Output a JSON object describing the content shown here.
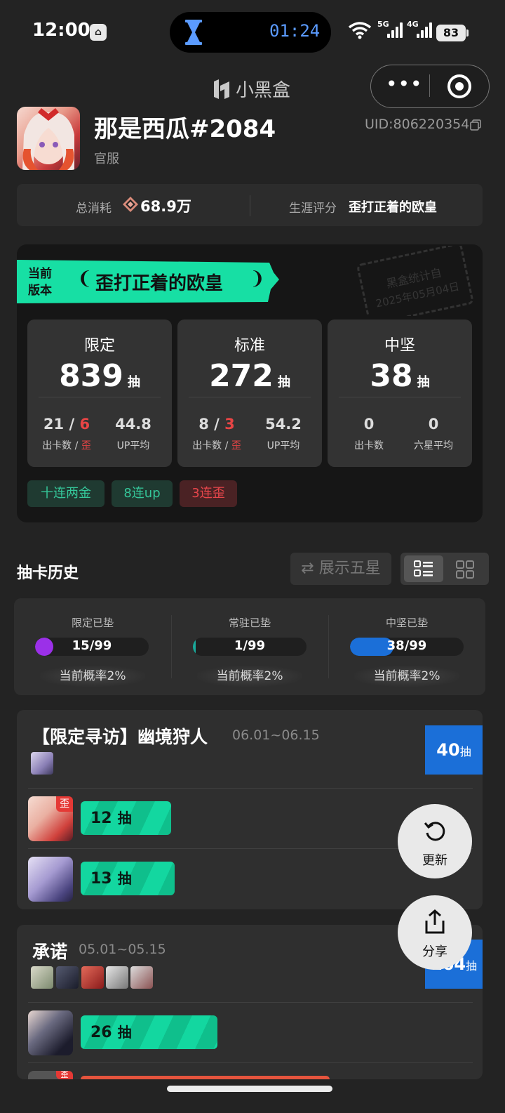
{
  "status_bar": {
    "time": "12:00",
    "timer": "01:24",
    "net1": "5G",
    "net2": "4G",
    "battery": "83"
  },
  "header": {
    "app_name": "小黑盒",
    "menu_dots": "•••"
  },
  "profile": {
    "name": "那是西瓜#2084",
    "server": "官服",
    "uid": "UID:806220354"
  },
  "summary": {
    "total_label": "总消耗",
    "total_value": "68.9万",
    "rating_label": "生涯评分",
    "rating_value": "歪打正着的欧皇"
  },
  "main_card": {
    "ribbon_line1": "当前",
    "ribbon_line2": "版本",
    "ribbon_title": "歪打正着的欧皇",
    "stamp_line1": "黑盒统计自",
    "stamp_line2": "2025年05月04日",
    "pull_unit": "抽",
    "stats": [
      {
        "title": "限定",
        "count": "839",
        "left_main": "21",
        "left_sep": " / ",
        "left_red": "6",
        "left_label": "出卡数",
        "left_label_sep": " / ",
        "left_label_red": "歪",
        "right_val": "44.8",
        "right_label": "UP平均"
      },
      {
        "title": "标准",
        "count": "272",
        "left_main": "8",
        "left_sep": " / ",
        "left_red": "3",
        "left_label": "出卡数",
        "left_label_sep": " / ",
        "left_label_red": "歪",
        "right_val": "54.2",
        "right_label": "UP平均"
      },
      {
        "title": "中坚",
        "count": "38",
        "left_main": "0",
        "left_label": "出卡数",
        "right_val": "0",
        "right_label": "六星平均"
      }
    ],
    "tags": [
      "十连两金",
      "8连up",
      "3连歪"
    ]
  },
  "history": {
    "title": "抽卡历史",
    "show_five": "⇄ 展示五星"
  },
  "pity": [
    {
      "label": "限定已垫",
      "value": "15/99",
      "fraction": 0.15,
      "rate": "当前概率2%",
      "color": "#9b30e8"
    },
    {
      "label": "常驻已垫",
      "value": "1/99",
      "fraction": 0.01,
      "rate": "当前概率2%",
      "color": "#1aa89a"
    },
    {
      "label": "中坚已垫",
      "value": "38/99",
      "fraction": 0.38,
      "rate": "当前概率2%",
      "color": "#1b6fd8"
    }
  ],
  "banners": [
    {
      "title": "【限定寻访】幽境狩人",
      "date": "06.01~06.15",
      "total": "40",
      "unit": "抽",
      "rows": [
        {
          "pulls": "12",
          "unit": "抽",
          "off_rate": true,
          "off_label": "歪"
        },
        {
          "pulls": "13",
          "unit": "抽",
          "off_rate": false
        }
      ]
    },
    {
      "title": "承诺",
      "date": "05.01~05.15",
      "total": "164",
      "unit": "抽",
      "rows": [
        {
          "pulls": "26",
          "unit": "抽",
          "off_rate": false
        },
        {
          "off_rate": true,
          "off_label": "歪"
        }
      ]
    }
  ],
  "fabs": {
    "refresh_label": "更新",
    "share_label": "分享"
  },
  "colors": {
    "accent_green": "#13d7a0",
    "accent_blue": "#1b6fd8",
    "accent_red": "#e84545"
  }
}
